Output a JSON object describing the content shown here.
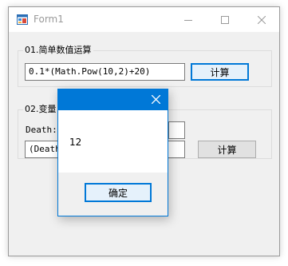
{
  "window": {
    "title": "Form1",
    "icons": {
      "app": "form-app-icon",
      "minimize": "minimize-icon",
      "maximize": "maximize-icon",
      "close": "close-icon"
    }
  },
  "group1": {
    "label": "01.简单数值运算",
    "expression": "0.1*(Math.Pow(10,2)+20)",
    "button": "计算"
  },
  "group2": {
    "label": "02.变量",
    "var_label": "Death:",
    "var_value": "",
    "expression": "(Death",
    "button": "计算"
  },
  "messagebox": {
    "message": "12",
    "ok": "确定",
    "close_icon": "close-icon"
  },
  "colors": {
    "accent": "#0078d7",
    "window_bg": "#f0f0f0"
  }
}
